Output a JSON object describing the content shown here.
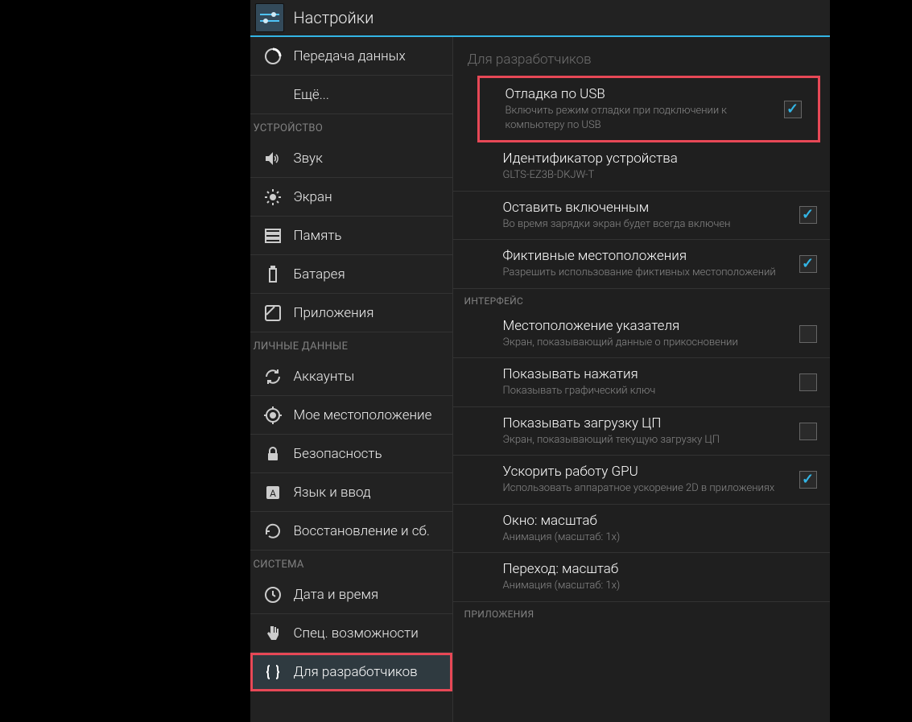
{
  "header": {
    "title": "Настройки"
  },
  "sidebar": {
    "items": [
      {
        "label": "Передача данных"
      },
      {
        "label": "Ещё..."
      }
    ],
    "cat_device": "УСТРОЙСТВО",
    "device": [
      {
        "label": "Звук"
      },
      {
        "label": "Экран"
      },
      {
        "label": "Память"
      },
      {
        "label": "Батарея"
      },
      {
        "label": "Приложения"
      }
    ],
    "cat_personal": "ЛИЧНЫЕ ДАННЫЕ",
    "personal": [
      {
        "label": "Аккаунты"
      },
      {
        "label": "Мое местоположение"
      },
      {
        "label": "Безопасность"
      },
      {
        "label": "Язык и ввод"
      },
      {
        "label": "Восстановление и сб."
      }
    ],
    "cat_system": "СИСТЕМА",
    "system": [
      {
        "label": "Дата и время"
      },
      {
        "label": "Спец. возможности"
      },
      {
        "label": "Для разработчиков"
      }
    ]
  },
  "main": {
    "section_title": "Для разработчиков",
    "prefs": {
      "usb_debug": {
        "title": "Отладка по USB",
        "summary": "Включить режим отладки при подключении к компьютеру по USB",
        "checked": true
      },
      "device_id": {
        "title": "Идентификатор устройства",
        "summary": "GLTS-EZ3B-DKJW-T"
      },
      "stay_awake": {
        "title": "Оставить включенным",
        "summary": "Во время зарядки экран будет всегда включен",
        "checked": true
      },
      "mock_loc": {
        "title": "Фиктивные местоположения",
        "summary": "Разрешить использование фиктивных местоположений",
        "checked": true
      },
      "pointer_loc": {
        "title": "Местоположение указателя",
        "summary": "Экран, показывающий данные о прикосновении",
        "checked": false
      },
      "show_touch": {
        "title": "Показывать нажатия",
        "summary": "Показывать графический ключ",
        "checked": false
      },
      "show_cpu": {
        "title": "Показывать загрузку ЦП",
        "summary": "Экран, показывающий текущую загрузку ЦП",
        "checked": false
      },
      "force_gpu": {
        "title": "Ускорить работу GPU",
        "summary": "Использовать аппаратное ускорение 2D в приложениях",
        "checked": true
      },
      "win_scale": {
        "title": "Окно: масштаб",
        "summary": "Анимация (масштаб: 1x)"
      },
      "trans_scale": {
        "title": "Переход: масштаб",
        "summary": "Анимация (масштаб: 1x)"
      }
    },
    "cat_interface": "ИНТЕРФЕЙС",
    "cat_apps": "ПРИЛОЖЕНИЯ"
  }
}
